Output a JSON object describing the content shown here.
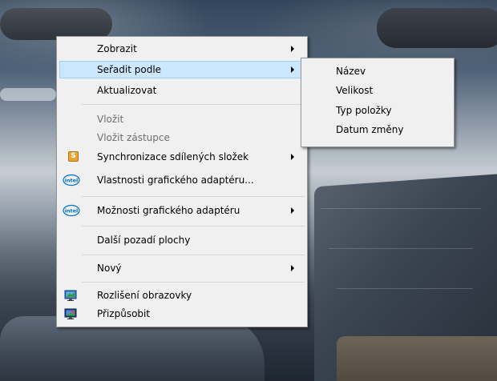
{
  "desktop": {
    "wallpaper": "ocean-rocks-sunset"
  },
  "context_menu": {
    "items": [
      {
        "label": "Zobrazit",
        "submenu": true
      },
      {
        "label": "Seřadit podle",
        "submenu": true,
        "highlighted": true
      },
      {
        "label": "Aktualizovat"
      },
      {
        "label": "Vložit",
        "disabled": true
      },
      {
        "label": "Vložit zástupce",
        "disabled": true
      },
      {
        "label": "Synchronizace sdílených složek",
        "submenu": true,
        "icon": "sync-shared-folders-icon"
      },
      {
        "label": "Vlastnosti grafického adaptéru...",
        "icon": "intel-icon"
      },
      {
        "label": "Možnosti grafického adaptéru",
        "submenu": true,
        "icon": "intel-icon"
      },
      {
        "label": "Další pozadí plochy"
      },
      {
        "label": "Nový",
        "submenu": true
      },
      {
        "label": "Rozlišení obrazovky",
        "icon": "screen-resolution-icon"
      },
      {
        "label": "Přizpůsobit",
        "icon": "personalize-icon"
      }
    ],
    "icon_labels": {
      "sync": "S",
      "intel": "intel"
    }
  },
  "sort_submenu": {
    "items": [
      {
        "label": "Název"
      },
      {
        "label": "Velikost"
      },
      {
        "label": "Typ položky"
      },
      {
        "label": "Datum změny"
      }
    ]
  },
  "colors": {
    "menu_background": "#f0f0f0",
    "highlight_background": "#cce8ff",
    "highlight_border": "#99d1ff",
    "disabled_text": "#6d6d6d"
  }
}
